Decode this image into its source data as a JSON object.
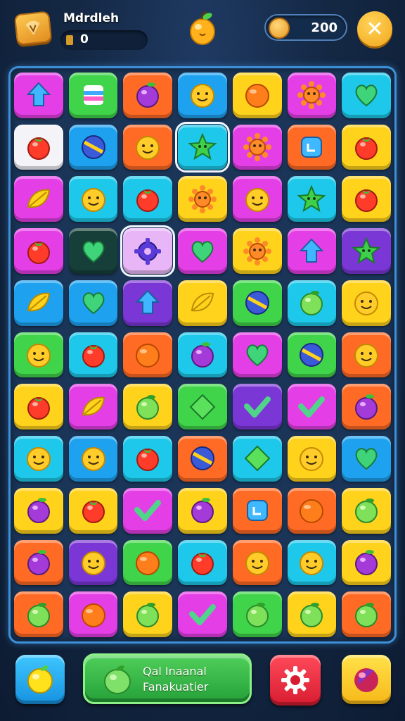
{
  "header": {
    "player_name": "Mdrdleh",
    "score": "0",
    "coins": "200",
    "level_icon": "diamond-badge-icon",
    "center_icon": "orange-fruit-icon",
    "close_icon": "close-icon"
  },
  "colors": {
    "magenta": "#e43fe6",
    "green": "#3fd44a",
    "orange": "#ff6a25",
    "blue": "#1ea2f0",
    "yellow": "#ffd21c",
    "cyan": "#1ec8ea",
    "pink": "#ff58c8",
    "purple": "#7b36d6",
    "red": "#ff3b3b",
    "darkgreen": "#173f3a",
    "white": "#f3f3f8",
    "lilac": "#e8b6f7"
  },
  "board": {
    "rows": 11,
    "cols": 7,
    "tiles": [
      [
        {
          "bg": "magenta",
          "icon": "arrow"
        },
        {
          "bg": "green",
          "icon": "cube"
        },
        {
          "bg": "orange",
          "icon": "berry"
        },
        {
          "bg": "blue",
          "icon": "smiley"
        },
        {
          "bg": "yellow",
          "icon": "orange"
        },
        {
          "bg": "magenta",
          "icon": "sun"
        },
        {
          "bg": "cyan",
          "icon": "heart"
        }
      ],
      [
        {
          "bg": "white",
          "icon": "tomato"
        },
        {
          "bg": "blue",
          "icon": "ball"
        },
        {
          "bg": "orange",
          "icon": "smiley"
        },
        {
          "bg": "cyan",
          "icon": "star",
          "selected": true
        },
        {
          "bg": "magenta",
          "icon": "sun"
        },
        {
          "bg": "orange",
          "icon": "square"
        },
        {
          "bg": "yellow",
          "icon": "tomato"
        }
      ],
      [
        {
          "bg": "magenta",
          "icon": "leaf"
        },
        {
          "bg": "cyan",
          "icon": "smiley"
        },
        {
          "bg": "cyan",
          "icon": "tomato"
        },
        {
          "bg": "yellow",
          "icon": "sun"
        },
        {
          "bg": "magenta",
          "icon": "smiley"
        },
        {
          "bg": "cyan",
          "icon": "star"
        },
        {
          "bg": "yellow",
          "icon": "tomato"
        }
      ],
      [
        {
          "bg": "magenta",
          "icon": "tomato"
        },
        {
          "bg": "darkgreen",
          "icon": "heart"
        },
        {
          "bg": "lilac",
          "icon": "gear",
          "selected": true
        },
        {
          "bg": "magenta",
          "icon": "heart"
        },
        {
          "bg": "yellow",
          "icon": "sun"
        },
        {
          "bg": "magenta",
          "icon": "arrow"
        },
        {
          "bg": "purple",
          "icon": "star"
        }
      ],
      [
        {
          "bg": "blue",
          "icon": "leaf"
        },
        {
          "bg": "blue",
          "icon": "heart"
        },
        {
          "bg": "purple",
          "icon": "arrow"
        },
        {
          "bg": "yellow",
          "icon": "leaf"
        },
        {
          "bg": "green",
          "icon": "ball"
        },
        {
          "bg": "cyan",
          "icon": "apple"
        },
        {
          "bg": "yellow",
          "icon": "smiley"
        }
      ],
      [
        {
          "bg": "green",
          "icon": "smiley"
        },
        {
          "bg": "cyan",
          "icon": "tomato"
        },
        {
          "bg": "orange",
          "icon": "orange"
        },
        {
          "bg": "cyan",
          "icon": "berry"
        },
        {
          "bg": "magenta",
          "icon": "heart"
        },
        {
          "bg": "green",
          "icon": "ball"
        },
        {
          "bg": "orange",
          "icon": "smiley"
        }
      ],
      [
        {
          "bg": "yellow",
          "icon": "tomato"
        },
        {
          "bg": "magenta",
          "icon": "leaf"
        },
        {
          "bg": "yellow",
          "icon": "apple"
        },
        {
          "bg": "green",
          "icon": "diamond"
        },
        {
          "bg": "purple",
          "icon": "check"
        },
        {
          "bg": "magenta",
          "icon": "check"
        },
        {
          "bg": "orange",
          "icon": "berry"
        }
      ],
      [
        {
          "bg": "cyan",
          "icon": "smiley"
        },
        {
          "bg": "blue",
          "icon": "smiley"
        },
        {
          "bg": "cyan",
          "icon": "tomato"
        },
        {
          "bg": "orange",
          "icon": "ball"
        },
        {
          "bg": "cyan",
          "icon": "diamond"
        },
        {
          "bg": "yellow",
          "icon": "smiley"
        },
        {
          "bg": "blue",
          "icon": "heart"
        }
      ],
      [
        {
          "bg": "yellow",
          "icon": "berry"
        },
        {
          "bg": "yellow",
          "icon": "tomato"
        },
        {
          "bg": "magenta",
          "icon": "check"
        },
        {
          "bg": "yellow",
          "icon": "berry"
        },
        {
          "bg": "orange",
          "icon": "square"
        },
        {
          "bg": "orange",
          "icon": "orange"
        },
        {
          "bg": "yellow",
          "icon": "apple"
        }
      ],
      [
        {
          "bg": "orange",
          "icon": "berry"
        },
        {
          "bg": "purple",
          "icon": "smiley"
        },
        {
          "bg": "green",
          "icon": "orange"
        },
        {
          "bg": "cyan",
          "icon": "tomato"
        },
        {
          "bg": "orange",
          "icon": "smiley"
        },
        {
          "bg": "cyan",
          "icon": "smiley"
        },
        {
          "bg": "yellow",
          "icon": "berry"
        }
      ],
      [
        {
          "bg": "orange",
          "icon": "apple"
        },
        {
          "bg": "magenta",
          "icon": "orange"
        },
        {
          "bg": "yellow",
          "icon": "apple"
        },
        {
          "bg": "magenta",
          "icon": "check"
        },
        {
          "bg": "green",
          "icon": "apple"
        },
        {
          "bg": "yellow",
          "icon": "apple"
        },
        {
          "bg": "orange",
          "icon": "apple"
        }
      ]
    ]
  },
  "footer": {
    "lemon_icon": "lemon-icon",
    "main_line1": "Qal Inaanal",
    "main_line2": "Fanakuatier",
    "main_icon": "apple-icon",
    "settings_icon": "gear-icon",
    "right_icon": "pomegranate-icon"
  }
}
